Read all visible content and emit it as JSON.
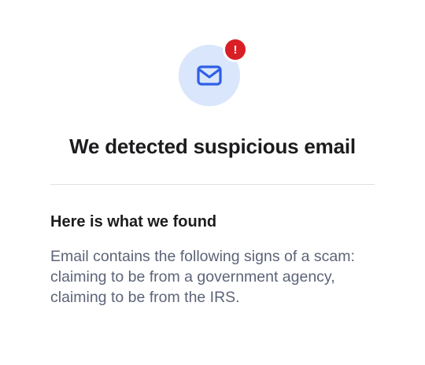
{
  "header": {
    "title": "We detected suspicious email"
  },
  "icons": {
    "main": "mail-icon",
    "badge": "alert-icon",
    "badge_glyph": "!"
  },
  "findings": {
    "heading": "Here is what we found",
    "description": "Email contains the following signs of a scam: claiming to be from a government agency, claiming to be from the IRS."
  },
  "colors": {
    "icon_bg": "#d9e6fb",
    "icon_stroke": "#2f5fe6",
    "badge": "#d91f26",
    "title_text": "#1c1c1e",
    "body_text": "#5d6478",
    "divider": "#dfe1e6"
  }
}
